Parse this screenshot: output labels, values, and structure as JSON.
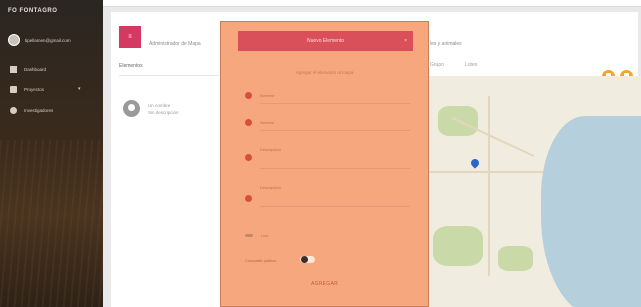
{
  "sidebar": {
    "brand": "FO  FONTAGRO",
    "user_email": "tipellamen@gmail.com",
    "items": [
      {
        "label": "Dashboard",
        "icon": "grid-icon"
      },
      {
        "label": "Proyectos",
        "icon": "document-icon",
        "has_caret": true
      },
      {
        "label": "Investigadores",
        "icon": "info-icon"
      }
    ]
  },
  "main": {
    "badge": "≡",
    "title": "Administrador de Mapa",
    "title_right": "les y animales",
    "tabs": {
      "elementos": "Elementos",
      "right_1": "Grupo",
      "right_2": "Lotes"
    },
    "pin_item": {
      "line1": "Un nombre",
      "line2": "Sin descripción"
    }
  },
  "modal": {
    "header": "Nuevo Elemento",
    "close": "×",
    "subtitle": "Agregar el elemento al mapa",
    "fields": [
      {
        "label": "Nombre"
      },
      {
        "label": "Nombre"
      },
      {
        "label": "Descripción"
      },
      {
        "label": "Descripción"
      }
    ],
    "link_label": "Link",
    "toggle_label": "Compartir público",
    "toggle_on": true,
    "submit": "AGREGAR"
  },
  "colors": {
    "accent": "#d63864",
    "modal_bg": "#f6a77d",
    "modal_header": "#d94f5a",
    "fab": "#f2a52a"
  }
}
